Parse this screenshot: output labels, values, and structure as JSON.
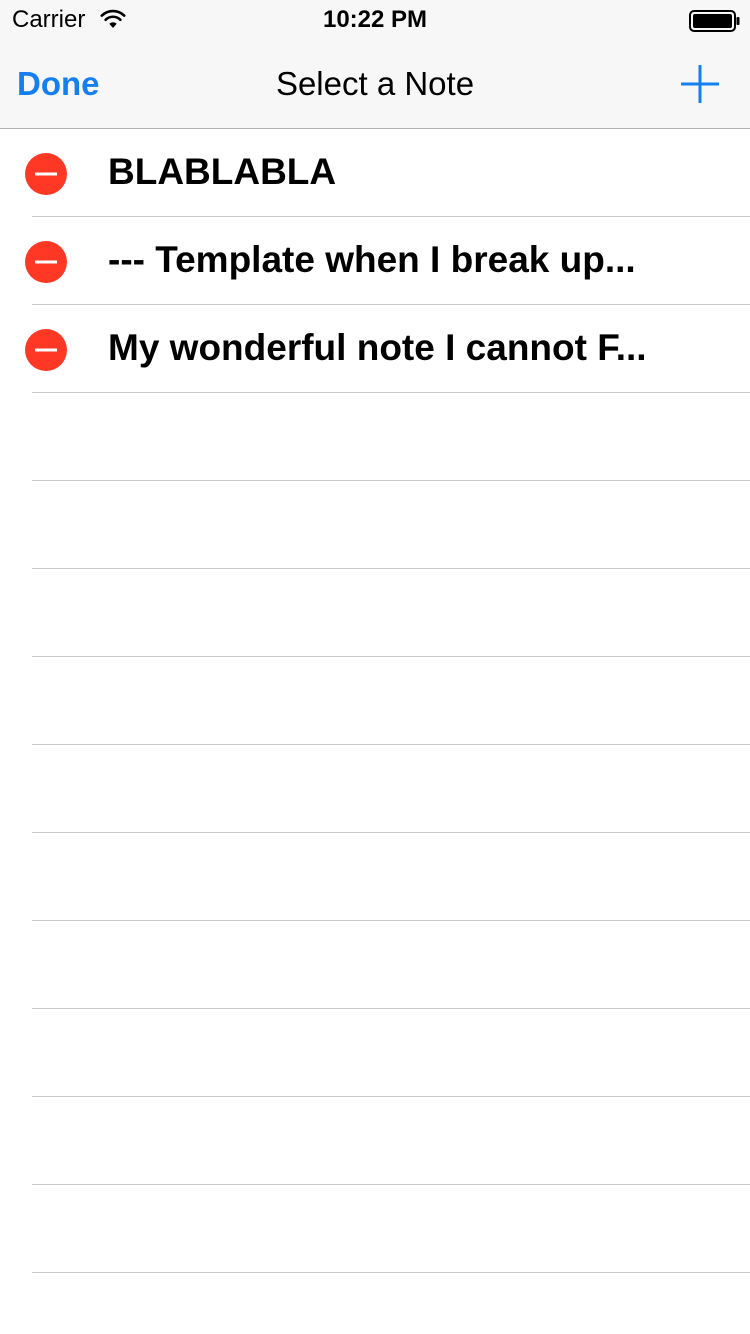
{
  "status_bar": {
    "carrier": "Carrier",
    "time": "10:22 PM",
    "wifi_icon": "wifi-icon",
    "battery_icon": "battery-full-icon"
  },
  "nav_bar": {
    "done_label": "Done",
    "title": "Select a Note",
    "add_icon": "plus-icon"
  },
  "notes": [
    {
      "title": "BLABLABLA"
    },
    {
      "title": "--- Template when I break up..."
    },
    {
      "title": "My wonderful note I cannot F..."
    }
  ],
  "colors": {
    "accent": "#137ff0",
    "delete": "#fe3824",
    "separator": "#c8c7cc",
    "nav_background": "#f7f7f7"
  }
}
